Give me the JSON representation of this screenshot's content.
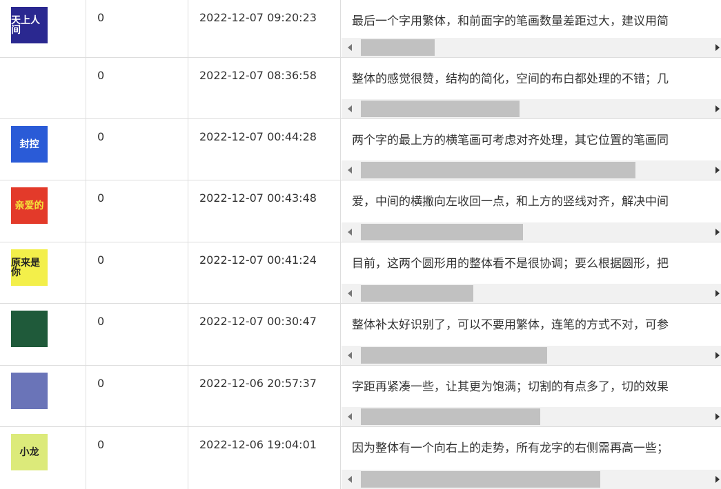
{
  "rows": [
    {
      "thumb": {
        "label": "天上人间",
        "bg": "#2a2890",
        "fg": "#ffffff",
        "icon": "poster-thumbnail"
      },
      "count": "0",
      "date": "2022-12-07 09:20:23",
      "comment": "最后一个字用繁体，和前面字的笔画数量差距过大，建议用简",
      "scroll_fraction": 0.21
    },
    {
      "thumb": {
        "label": "",
        "bg": "#ffffff",
        "fg": "#222222",
        "icon": "poster-thumbnail"
      },
      "count": "0",
      "date": "2022-12-07 08:36:58",
      "comment": "整体的感觉很赞，结构的简化，空间的布白都处理的不错；几",
      "scroll_fraction": 0.45
    },
    {
      "thumb": {
        "label": "封控",
        "bg": "#2a5bd7",
        "fg": "#ffffff",
        "icon": "poster-thumbnail"
      },
      "count": "0",
      "date": "2022-12-07 00:44:28",
      "comment": "两个字的最上方的横笔画可考虑对齐处理，其它位置的笔画同",
      "scroll_fraction": 0.78
    },
    {
      "thumb": {
        "label": "亲爱的",
        "bg": "#e33a2a",
        "fg": "#f5e33a",
        "icon": "poster-thumbnail"
      },
      "count": "0",
      "date": "2022-12-07 00:43:48",
      "comment": "爱，中间的横撇向左收回一点，和上方的竖线对齐，解决中间",
      "scroll_fraction": 0.46
    },
    {
      "thumb": {
        "label": "原来是你",
        "bg": "#f3ef4a",
        "fg": "#222222",
        "icon": "poster-thumbnail"
      },
      "count": "0",
      "date": "2022-12-07 00:41:24",
      "comment": "目前，这两个圆形用的整体看不是很协调；要么根据圆形，把",
      "scroll_fraction": 0.32
    },
    {
      "thumb": {
        "label": "",
        "bg": "#1f5a3a",
        "fg": "#ef4a2a",
        "icon": "poster-thumbnail"
      },
      "count": "0",
      "date": "2022-12-07 00:30:47",
      "comment": "整体补太好识别了，可以不要用繁体，连笔的方式不对，可参",
      "scroll_fraction": 0.53
    },
    {
      "thumb": {
        "label": "",
        "bg": "#6a74b8",
        "fg": "#ffffff",
        "icon": "poster-thumbnail"
      },
      "count": "0",
      "date": "2022-12-06 20:57:37",
      "comment": "字距再紧凑一些，让其更为饱满；切割的有点多了，切的效果",
      "scroll_fraction": 0.51
    },
    {
      "thumb": {
        "label": "小龙",
        "bg": "#dcea7a",
        "fg": "#222222",
        "icon": "poster-thumbnail"
      },
      "count": "0",
      "date": "2022-12-06 19:04:01",
      "comment": "因为整体有一个向右上的走势，所有龙字的右侧需再高一些；",
      "scroll_fraction": 0.68
    }
  ]
}
